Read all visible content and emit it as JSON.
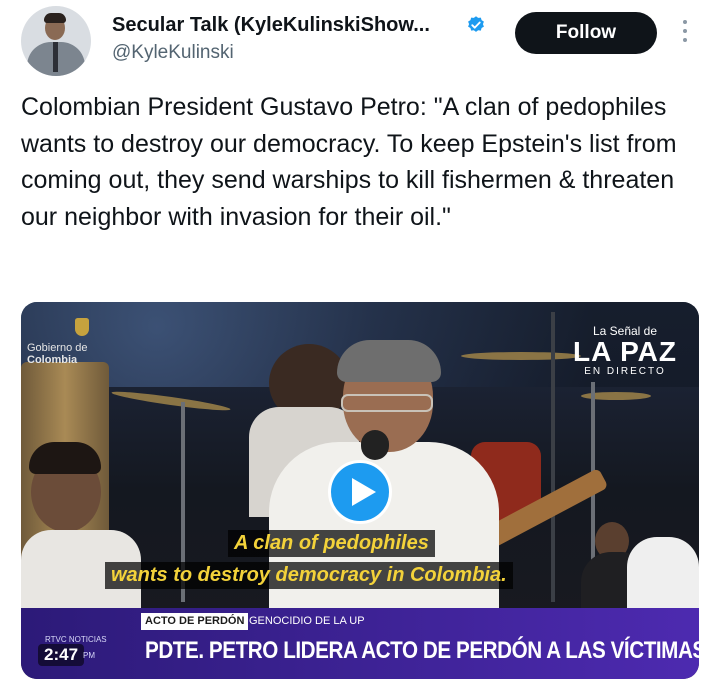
{
  "author": {
    "display_name": "Secular Talk (KyleKulinskiShow...",
    "handle": "@KyleKulinski",
    "verified": true
  },
  "actions": {
    "follow_label": "Follow",
    "more_icon": "more-vertical-icon"
  },
  "tweet": {
    "text": "Colombian President Gustavo Petro: \"A clan of pedophiles wants to destroy our democracy. To keep Epstein's list from coming out, they send warships to kill fishermen & threaten our neighbor with invasion for their oil.\""
  },
  "video": {
    "logo_gov_line1": "Gobierno de",
    "logo_gov_line2": "Colombia",
    "channel_line1": "La Señal de",
    "channel_line2": "LA PAZ",
    "channel_line3": "EN DIRECTO",
    "subtitle_line1": "A clan of pedophiles",
    "subtitle_line2": "wants to destroy democracy in Colombia.",
    "tag_label": "ACTO DE PERDÓN",
    "tag_subtitle": "GENOCIDIO DE LA UP",
    "headline": "PDTE. PETRO LIDERA ACTO DE PERDÓN A LAS VÍCTIMAS",
    "network_label": "RTVC NOTICIAS",
    "duration": "2:47",
    "time_suffix": "PM"
  },
  "colors": {
    "accent": "#1d9bf0",
    "subtitle": "#f3d23a",
    "lower_third": "#4d2ab0"
  }
}
